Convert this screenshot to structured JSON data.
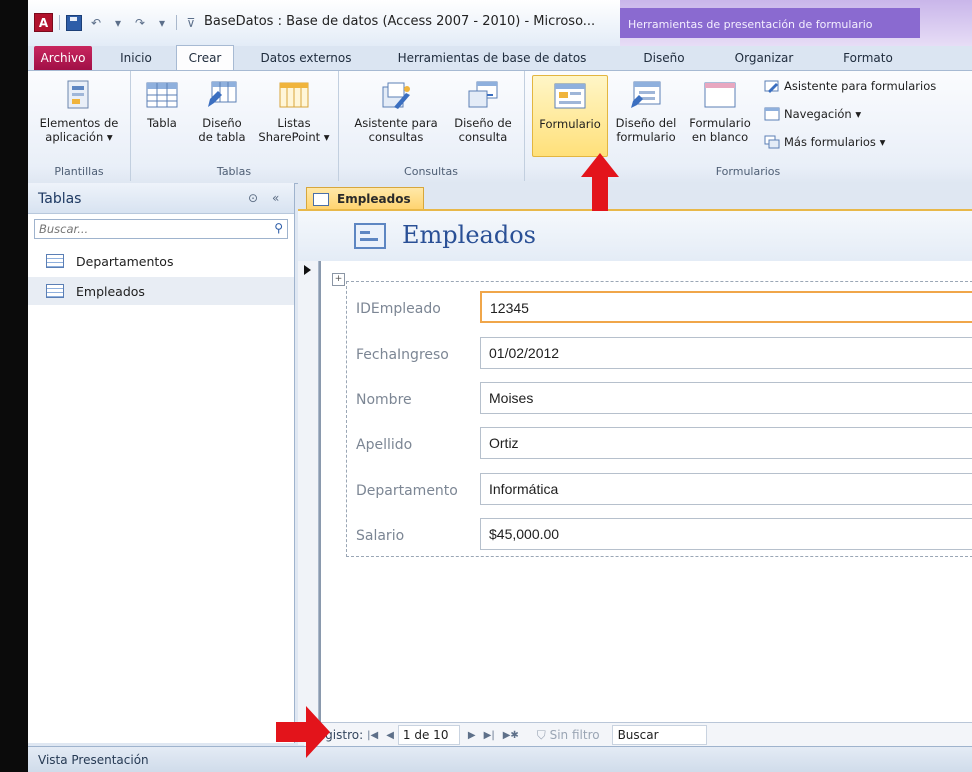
{
  "window": {
    "title": "BaseDatos : Base de datos (Access 2007 - 2010) - Microso...",
    "context_title": "Herramientas de presentación de formulario",
    "app_icon_letter": "A"
  },
  "tabs": {
    "file": "Archivo",
    "home": "Inicio",
    "create": "Crear",
    "external": "Datos externos",
    "dbtools": "Herramientas de base de datos",
    "design": "Diseño",
    "arrange": "Organizar",
    "format": "Formato"
  },
  "ribbon": {
    "templates": {
      "label": "Plantillas",
      "app_parts_1": "Elementos de",
      "app_parts_2": "aplicación ▾"
    },
    "tables": {
      "label": "Tablas",
      "table": "Tabla",
      "table_design_1": "Diseño",
      "table_design_2": "de tabla",
      "sharepoint_1": "Listas",
      "sharepoint_2": "SharePoint ▾"
    },
    "queries": {
      "label": "Consultas",
      "wizard_1": "Asistente para",
      "wizard_2": "consultas",
      "design_1": "Diseño de",
      "design_2": "consulta"
    },
    "forms": {
      "label": "Formularios",
      "form": "Formulario",
      "form_design_1": "Diseño del",
      "form_design_2": "formulario",
      "blank_1": "Formulario",
      "blank_2": "en blanco",
      "wizard": "Asistente para formularios",
      "navigation": "Navegación ▾",
      "more": "Más formularios ▾"
    }
  },
  "nav_pane": {
    "title": "Tablas",
    "search_placeholder": "Buscar...",
    "items": [
      {
        "label": "Departamentos"
      },
      {
        "label": "Empleados"
      }
    ]
  },
  "document": {
    "tab": "Empleados",
    "form_title": "Empleados",
    "fields": [
      {
        "label": "IDEmpleado",
        "value": "12345"
      },
      {
        "label": "FechaIngreso",
        "value": "01/02/2012"
      },
      {
        "label": "Nombre",
        "value": "Moises"
      },
      {
        "label": "Apellido",
        "value": "Ortiz"
      },
      {
        "label": "Departamento",
        "value": "Informática"
      },
      {
        "label": "Salario",
        "value": "$45,000.00"
      }
    ]
  },
  "record_nav": {
    "label": "Registro:",
    "position": "1 de 10",
    "filter": "Sin filtro",
    "search": "Buscar"
  },
  "status": {
    "text": "Vista Presentación"
  },
  "colors": {
    "accent_red": "#e3141b",
    "file_tab": "#b3174f",
    "context_tab": "#8a6ad0"
  }
}
